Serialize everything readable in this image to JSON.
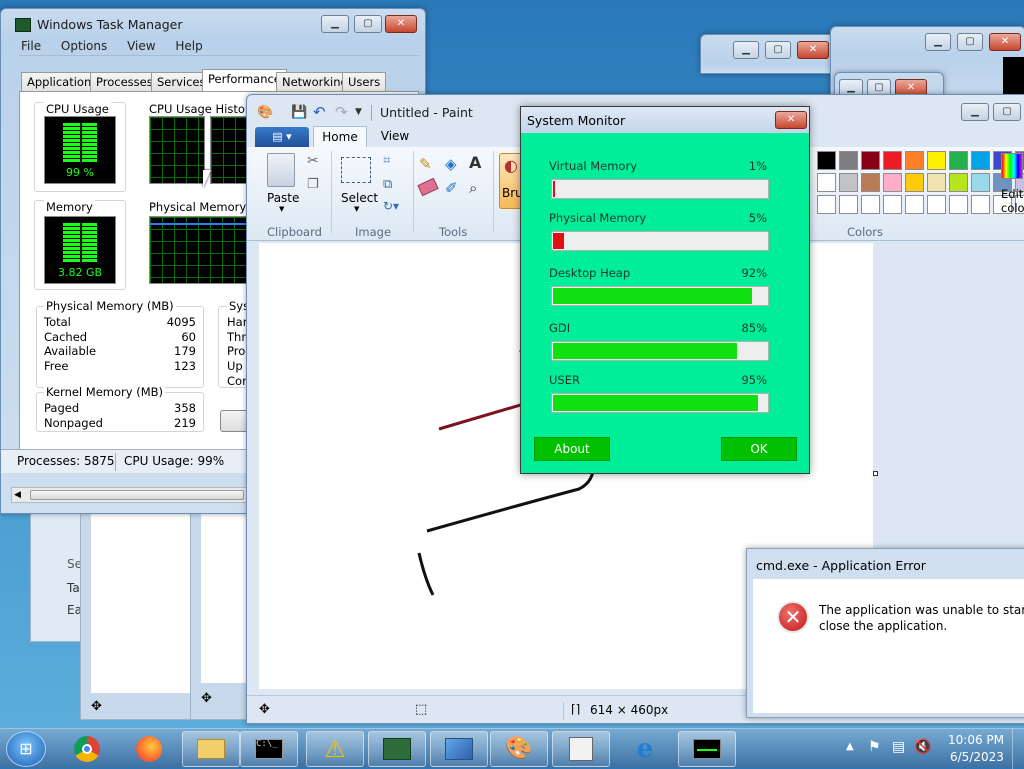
{
  "task_manager": {
    "title": "Windows Task Manager",
    "menu": [
      "File",
      "Options",
      "View",
      "Help"
    ],
    "tabs": [
      "Applications",
      "Processes",
      "Services",
      "Performance",
      "Networking",
      "Users"
    ],
    "active_tab": "Performance",
    "cpu_usage_label": "CPU Usage",
    "cpu_usage_value": "99 %",
    "cpu_history_label": "CPU Usage History",
    "memory_label": "Memory",
    "memory_value": "3.82 GB",
    "physical_memory_usage_label": "Physical Memory Usa",
    "physical_memory_header": "Physical Memory (MB)",
    "physical_memory": [
      {
        "label": "Total",
        "value": "4095"
      },
      {
        "label": "Cached",
        "value": "60"
      },
      {
        "label": "Available",
        "value": "179"
      },
      {
        "label": "Free",
        "value": "123"
      }
    ],
    "kernel_memory_header": "Kernel Memory (MB)",
    "kernel_memory": [
      {
        "label": "Paged",
        "value": "358"
      },
      {
        "label": "Nonpaged",
        "value": "219"
      }
    ],
    "system_header": "Syst",
    "system_rows": [
      "Han",
      "Thre",
      "Proc",
      "Up T",
      "Com"
    ],
    "status_processes": "Processes: 5875",
    "status_cpu": "CPU Usage: 99%"
  },
  "paint": {
    "title": "Untitled - Paint",
    "tabs": [
      "Home",
      "View"
    ],
    "active_tab": "Home",
    "paste_label": "Paste",
    "select_label": "Select",
    "brush_label": "Brus",
    "edit_colors_label_1": "Edit",
    "edit_colors_label_2": "colo",
    "groups": [
      "Clipboard",
      "Image",
      "Tools",
      "Colors"
    ],
    "status_size": "614 × 460px"
  },
  "system_monitor": {
    "title": "System Monitor",
    "rows": [
      {
        "label": "Virtual Memory",
        "pct": "1%",
        "fraction": 0.01,
        "color": "#e01010"
      },
      {
        "label": "Physical Memory",
        "pct": "5%",
        "fraction": 0.05,
        "color": "#e01010"
      },
      {
        "label": "Desktop Heap",
        "pct": "92%",
        "fraction": 0.92,
        "color": "#10e010"
      },
      {
        "label": "GDI",
        "pct": "85%",
        "fraction": 0.85,
        "color": "#10e010"
      },
      {
        "label": "USER",
        "pct": "95%",
        "fraction": 0.95,
        "color": "#10e010"
      }
    ],
    "about_label": "About",
    "ok_label": "OK"
  },
  "error_dialog": {
    "title": "cmd.exe - Application Error",
    "message_line1": "The application was unable to start corr",
    "message_line2": "close the application."
  },
  "background_window": {
    "items": [
      "Se",
      "Ta",
      "Ea"
    ]
  },
  "taskbar": {
    "time": "10:06 PM",
    "date": "6/5/2023",
    "apps": [
      "start-orb",
      "chrome",
      "firefox",
      "file-explorer",
      "cmd",
      "warning",
      "task-manager",
      "control-panel",
      "paint",
      "notepad",
      "internet-explorer",
      "system-monitor"
    ]
  },
  "palette": [
    "#000000",
    "#7f7f7f",
    "#880015",
    "#ed1c24",
    "#ff7f27",
    "#fff200",
    "#22b14c",
    "#00a2e8",
    "#3f48cc",
    "#a349a4",
    "#ffffff",
    "#c3c3c3",
    "#b97a57",
    "#ffaec9",
    "#ffc90e",
    "#efe4b0",
    "#b5e61d",
    "#99d9ea",
    "#7092be",
    "#c8bfe7"
  ]
}
